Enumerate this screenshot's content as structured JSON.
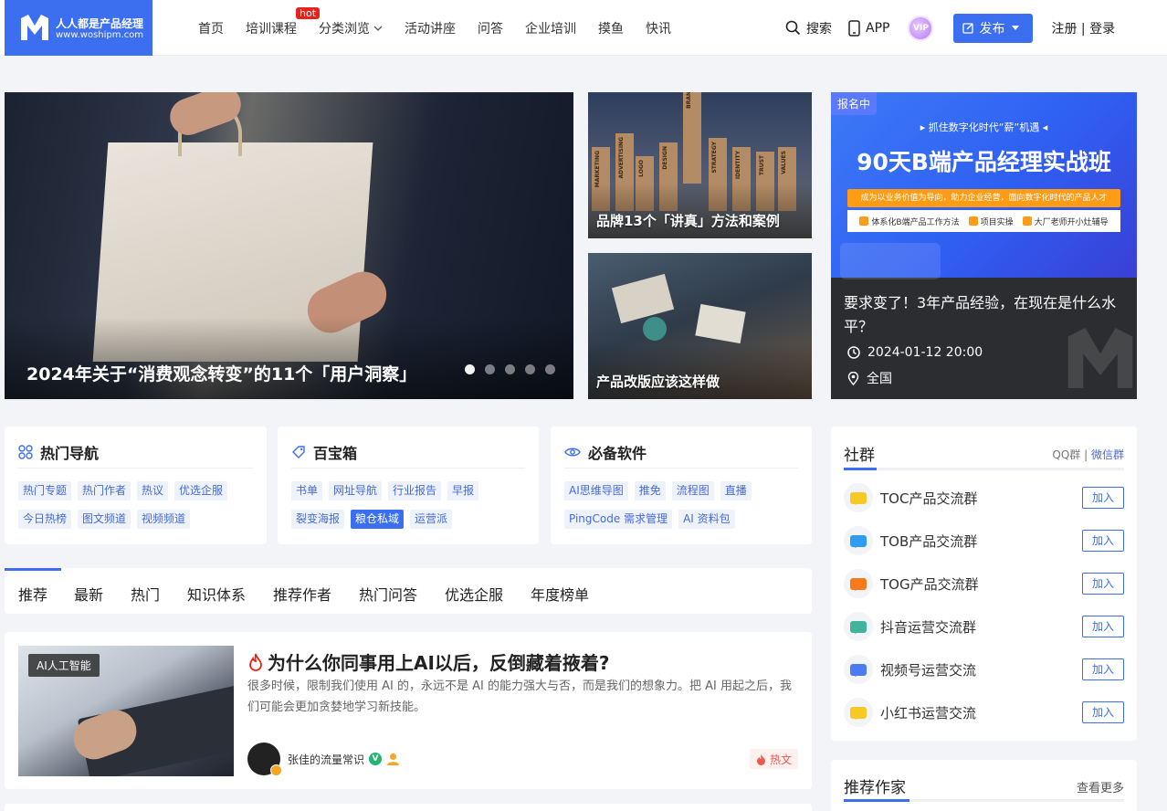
{
  "logo": {
    "name": "人人都是产品经理",
    "url": "www.woshipm.com"
  },
  "nav": {
    "items": [
      {
        "label": "首页"
      },
      {
        "label": "培训课程",
        "badge": "hot"
      },
      {
        "label": "分类浏览",
        "dropdown": true
      },
      {
        "label": "活动讲座"
      },
      {
        "label": "问答"
      },
      {
        "label": "企业培训"
      },
      {
        "label": "摸鱼"
      },
      {
        "label": "快讯"
      }
    ]
  },
  "header": {
    "search_label": "搜索",
    "app_label": "APP",
    "vip_label": "VIP",
    "publish_label": "发布",
    "auth_label": "注册 | 登录"
  },
  "hero": {
    "main_title": "2024年关于“消费观念转变”的11个「用户洞察」",
    "slide_count": 5,
    "active_slide": 0,
    "tile1_title": "品牌13个「讲真」方法和案例",
    "tile2_title": "产品改版应该这样做",
    "block_words": [
      "MARKETING",
      "ADVERTISING",
      "LOGO",
      "DESIGN",
      "BRAND",
      "STRATEGY",
      "IDENTITY",
      "TRUST",
      "VALUES"
    ]
  },
  "event": {
    "badge": "报名中",
    "tagline": "▸ 抓住数字化时代“薪”机遇 ◂",
    "headline": "90天B端产品经理实战班",
    "sub": "成为以业务价值为导向，助力企业经营，面向数字化时代的产品人才",
    "features": [
      "体系化B端产品工作方法",
      "项目实操",
      "大厂老师开小灶辅导"
    ],
    "title": "要求变了！3年产品经验，在现在是什么水平？",
    "time": "2024-01-12 20:00",
    "location": "全国"
  },
  "nav_cards": [
    {
      "title": "热门导航",
      "tags": [
        "热门专题",
        "热门作者",
        "热议",
        "优选企服",
        "今日热榜",
        "图文频道",
        "视频频道"
      ]
    },
    {
      "title": "百宝箱",
      "tags": [
        "书单",
        "网址导航",
        "行业报告",
        "早报",
        "裂变海报",
        "粮仓私域",
        "运营派"
      ],
      "active": "粮仓私域"
    },
    {
      "title": "必备软件",
      "tags": [
        "AI思维导图",
        "推免",
        "流程图",
        "直播",
        "PingCode 需求管理",
        "AI 资料包"
      ]
    }
  ],
  "tabs": {
    "items": [
      "推荐",
      "最新",
      "热门",
      "知识体系",
      "推荐作者",
      "热门问答",
      "优选企服",
      "年度榜单"
    ],
    "active": "推荐"
  },
  "article": {
    "category": "AI人工智能",
    "title": "为什么你同事用上AI以后，反倒藏着掖着?",
    "desc": "很多时候，限制我们使用 AI 的，永远不是 AI 的能力强大与否，而是我们的想象力。把 AI 用起之后，我们可能会更加贪婪地学习新技能。",
    "author": "张佳的流量常识",
    "verified_label": "V",
    "hot_label": "热文"
  },
  "community": {
    "title": "社群",
    "link_qq": "QQ群",
    "link_sep": "|",
    "link_wx": "微信群",
    "join_label": "加入",
    "groups": [
      {
        "name": "TOC产品交流群",
        "color": "#f7c925"
      },
      {
        "name": "TOB产品交流群",
        "color": "#2f9bf2"
      },
      {
        "name": "TOG产品交流群",
        "color": "#f67a1b"
      },
      {
        "name": "抖音运营交流群",
        "color": "#41b49b"
      },
      {
        "name": "视频号运营交流",
        "color": "#4c7af0"
      },
      {
        "name": "小红书运营交流",
        "color": "#f7c925"
      }
    ]
  },
  "writers": {
    "title": "推荐作家",
    "more_label": "查看更多"
  },
  "colors": {
    "accent": "#3b6ff0",
    "hot": "#e5231c"
  }
}
